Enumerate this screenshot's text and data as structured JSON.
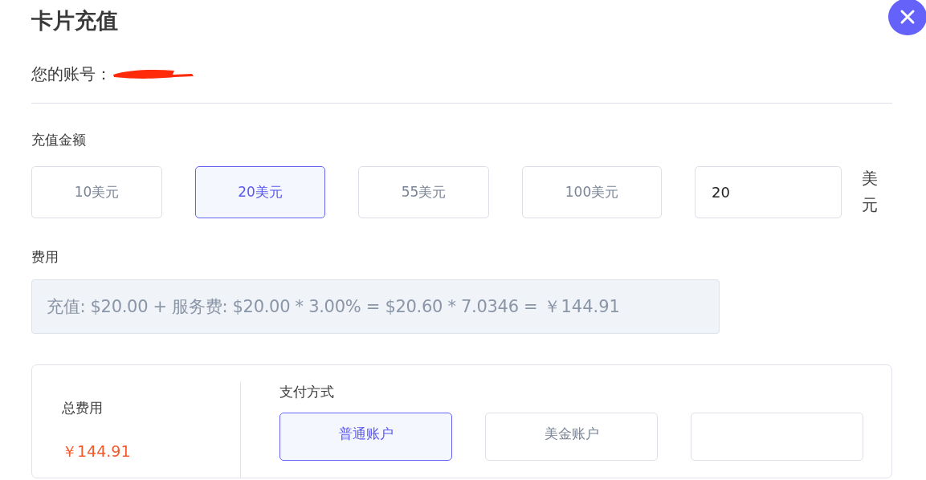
{
  "title": "卡片充值",
  "account": {
    "label": "您的账号："
  },
  "amount_label": "充值金额",
  "amount_options": [
    {
      "label": "10美元",
      "selected": false
    },
    {
      "label": "20美元",
      "selected": true
    },
    {
      "label": "55美元",
      "selected": false
    },
    {
      "label": "100美元",
      "selected": false
    }
  ],
  "custom_amount": {
    "value": "20",
    "unit": "美元"
  },
  "fee_label": "费用",
  "fee": {
    "formula": "充值: $20.00 + 服务费: $20.00 * 3.00% = $20.60 * 7.0346 =",
    "total": "￥144.91"
  },
  "summary": {
    "total_label": "总费用",
    "total_value": "￥144.91",
    "payment_label": "支付方式",
    "payment_methods": [
      {
        "label": "普通账户",
        "selected": true
      },
      {
        "label": "美金账户",
        "selected": false
      },
      {
        "selected": false
      }
    ]
  }
}
